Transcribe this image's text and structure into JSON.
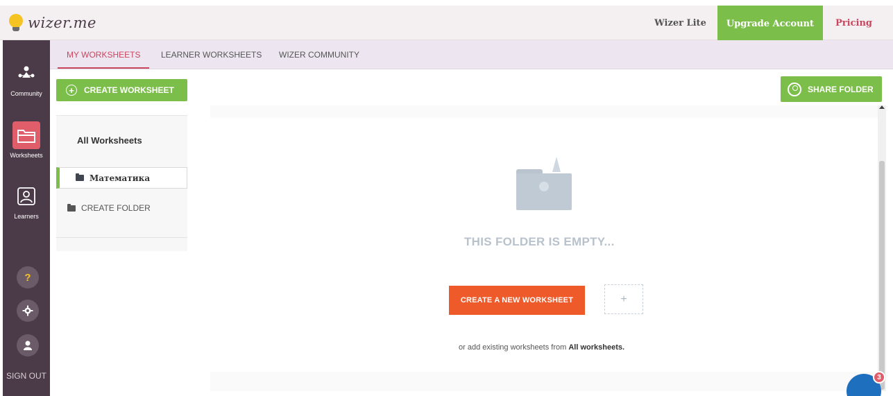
{
  "header": {
    "logo_text": "wizer.me",
    "plan_label": "Wizer Lite",
    "upgrade_label": "Upgrade Account",
    "pricing_label": "Pricing"
  },
  "rail": {
    "items": [
      {
        "label": "Community",
        "icon": "community-icon"
      },
      {
        "label": "Worksheets",
        "icon": "folder-icon"
      },
      {
        "label": "Learners",
        "icon": "learners-icon"
      }
    ],
    "help_glyph": "?",
    "signout_label": "SIGN OUT"
  },
  "tabs": [
    {
      "label": "MY WORKSHEETS",
      "active": true
    },
    {
      "label": "LEARNER WORKSHEETS",
      "active": false
    },
    {
      "label": "WIZER COMMUNITY",
      "active": false
    }
  ],
  "sidebar": {
    "create_worksheet_label": "CREATE WORKSHEET",
    "all_worksheets_label": "All Worksheets",
    "folders": [
      {
        "label": "Математика",
        "selected": true
      }
    ],
    "create_folder_label": "CREATE FOLDER"
  },
  "main": {
    "share_folder_label": "SHARE FOLDER",
    "empty_title": "THIS FOLDER IS EMPTY...",
    "create_new_label": "CREATE A NEW WORKSHEET",
    "add_plus": "+",
    "hint_prefix": "or add existing worksheets from ",
    "hint_link": "All worksheets."
  },
  "chat": {
    "badge_count": "3"
  },
  "colors": {
    "accent_green": "#7cbe4a",
    "accent_red": "#c9465e",
    "cta_orange": "#ef5a2a",
    "rail_bg": "#4b3b48"
  }
}
